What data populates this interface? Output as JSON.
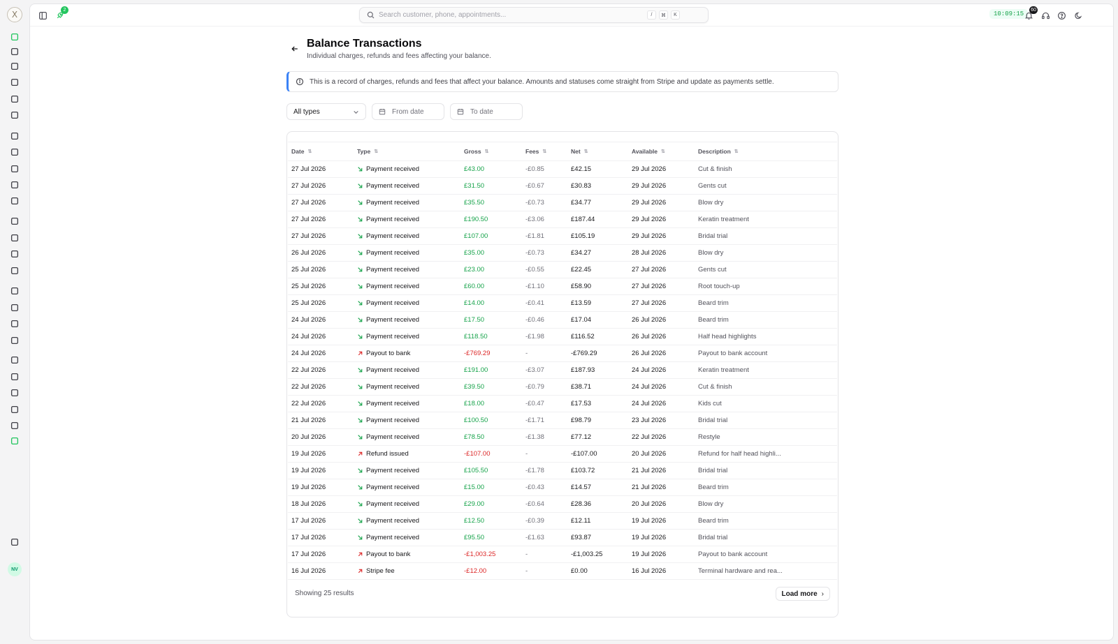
{
  "rail": {
    "logo_glyph": "X",
    "avatar_initials": "NV",
    "active_color": "#22c55e"
  },
  "topbar": {
    "notification_count": "2",
    "search_placeholder": "Search customer, phone, appointments...",
    "shortcut_keys": [
      "/",
      "⌘",
      "K"
    ],
    "clock": "10:09:15",
    "bell_count": "60"
  },
  "page": {
    "title": "Balance Transactions",
    "subtitle": "Individual charges, refunds and fees affecting your balance.",
    "info_text": "This is a record of charges, refunds and fees that affect your balance. Amounts and statuses come straight from Stripe and update as payments settle."
  },
  "filters": {
    "type_value": "All types",
    "from_placeholder": "From date",
    "to_placeholder": "To date"
  },
  "table": {
    "columns": [
      "Date",
      "Type",
      "Gross",
      "Fees",
      "Net",
      "Available",
      "Description"
    ],
    "rows": [
      {
        "date": "27 Jul 2026",
        "type": "Payment received",
        "direction": "in",
        "gross": "£43.00",
        "fees": "-£0.85",
        "net": "£42.15",
        "available": "29 Jul 2026",
        "description": "Cut & finish"
      },
      {
        "date": "27 Jul 2026",
        "type": "Payment received",
        "direction": "in",
        "gross": "£31.50",
        "fees": "-£0.67",
        "net": "£30.83",
        "available": "29 Jul 2026",
        "description": "Gents cut"
      },
      {
        "date": "27 Jul 2026",
        "type": "Payment received",
        "direction": "in",
        "gross": "£35.50",
        "fees": "-£0.73",
        "net": "£34.77",
        "available": "29 Jul 2026",
        "description": "Blow dry"
      },
      {
        "date": "27 Jul 2026",
        "type": "Payment received",
        "direction": "in",
        "gross": "£190.50",
        "fees": "-£3.06",
        "net": "£187.44",
        "available": "29 Jul 2026",
        "description": "Keratin treatment"
      },
      {
        "date": "27 Jul 2026",
        "type": "Payment received",
        "direction": "in",
        "gross": "£107.00",
        "fees": "-£1.81",
        "net": "£105.19",
        "available": "29 Jul 2026",
        "description": "Bridal trial"
      },
      {
        "date": "26 Jul 2026",
        "type": "Payment received",
        "direction": "in",
        "gross": "£35.00",
        "fees": "-£0.73",
        "net": "£34.27",
        "available": "28 Jul 2026",
        "description": "Blow dry"
      },
      {
        "date": "25 Jul 2026",
        "type": "Payment received",
        "direction": "in",
        "gross": "£23.00",
        "fees": "-£0.55",
        "net": "£22.45",
        "available": "27 Jul 2026",
        "description": "Gents cut"
      },
      {
        "date": "25 Jul 2026",
        "type": "Payment received",
        "direction": "in",
        "gross": "£60.00",
        "fees": "-£1.10",
        "net": "£58.90",
        "available": "27 Jul 2026",
        "description": "Root touch-up"
      },
      {
        "date": "25 Jul 2026",
        "type": "Payment received",
        "direction": "in",
        "gross": "£14.00",
        "fees": "-£0.41",
        "net": "£13.59",
        "available": "27 Jul 2026",
        "description": "Beard trim"
      },
      {
        "date": "24 Jul 2026",
        "type": "Payment received",
        "direction": "in",
        "gross": "£17.50",
        "fees": "-£0.46",
        "net": "£17.04",
        "available": "26 Jul 2026",
        "description": "Beard trim"
      },
      {
        "date": "24 Jul 2026",
        "type": "Payment received",
        "direction": "in",
        "gross": "£118.50",
        "fees": "-£1.98",
        "net": "£116.52",
        "available": "26 Jul 2026",
        "description": "Half head highlights"
      },
      {
        "date": "24 Jul 2026",
        "type": "Payout to bank",
        "direction": "out",
        "gross": "-£769.29",
        "fees": "-",
        "net": "-£769.29",
        "available": "26 Jul 2026",
        "description": "Payout to bank account"
      },
      {
        "date": "22 Jul 2026",
        "type": "Payment received",
        "direction": "in",
        "gross": "£191.00",
        "fees": "-£3.07",
        "net": "£187.93",
        "available": "24 Jul 2026",
        "description": "Keratin treatment"
      },
      {
        "date": "22 Jul 2026",
        "type": "Payment received",
        "direction": "in",
        "gross": "£39.50",
        "fees": "-£0.79",
        "net": "£38.71",
        "available": "24 Jul 2026",
        "description": "Cut & finish"
      },
      {
        "date": "22 Jul 2026",
        "type": "Payment received",
        "direction": "in",
        "gross": "£18.00",
        "fees": "-£0.47",
        "net": "£17.53",
        "available": "24 Jul 2026",
        "description": "Kids cut"
      },
      {
        "date": "21 Jul 2026",
        "type": "Payment received",
        "direction": "in",
        "gross": "£100.50",
        "fees": "-£1.71",
        "net": "£98.79",
        "available": "23 Jul 2026",
        "description": "Bridal trial"
      },
      {
        "date": "20 Jul 2026",
        "type": "Payment received",
        "direction": "in",
        "gross": "£78.50",
        "fees": "-£1.38",
        "net": "£77.12",
        "available": "22 Jul 2026",
        "description": "Restyle"
      },
      {
        "date": "19 Jul 2026",
        "type": "Refund issued",
        "direction": "out",
        "gross": "-£107.00",
        "fees": "-",
        "net": "-£107.00",
        "available": "20 Jul 2026",
        "description": "Refund for half head highli..."
      },
      {
        "date": "19 Jul 2026",
        "type": "Payment received",
        "direction": "in",
        "gross": "£105.50",
        "fees": "-£1.78",
        "net": "£103.72",
        "available": "21 Jul 2026",
        "description": "Bridal trial"
      },
      {
        "date": "19 Jul 2026",
        "type": "Payment received",
        "direction": "in",
        "gross": "£15.00",
        "fees": "-£0.43",
        "net": "£14.57",
        "available": "21 Jul 2026",
        "description": "Beard trim"
      },
      {
        "date": "18 Jul 2026",
        "type": "Payment received",
        "direction": "in",
        "gross": "£29.00",
        "fees": "-£0.64",
        "net": "£28.36",
        "available": "20 Jul 2026",
        "description": "Blow dry"
      },
      {
        "date": "17 Jul 2026",
        "type": "Payment received",
        "direction": "in",
        "gross": "£12.50",
        "fees": "-£0.39",
        "net": "£12.11",
        "available": "19 Jul 2026",
        "description": "Beard trim"
      },
      {
        "date": "17 Jul 2026",
        "type": "Payment received",
        "direction": "in",
        "gross": "£95.50",
        "fees": "-£1.63",
        "net": "£93.87",
        "available": "19 Jul 2026",
        "description": "Bridal trial"
      },
      {
        "date": "17 Jul 2026",
        "type": "Payout to bank",
        "direction": "out",
        "gross": "-£1,003.25",
        "fees": "-",
        "net": "-£1,003.25",
        "available": "19 Jul 2026",
        "description": "Payout to bank account"
      },
      {
        "date": "16 Jul 2026",
        "type": "Stripe fee",
        "direction": "out",
        "gross": "-£12.00",
        "fees": "-",
        "net": "£0.00",
        "available": "16 Jul 2026",
        "description": "Terminal hardware and rea..."
      }
    ]
  },
  "footer": {
    "results_text": "Showing 25 results",
    "load_more_label": "Load more"
  }
}
